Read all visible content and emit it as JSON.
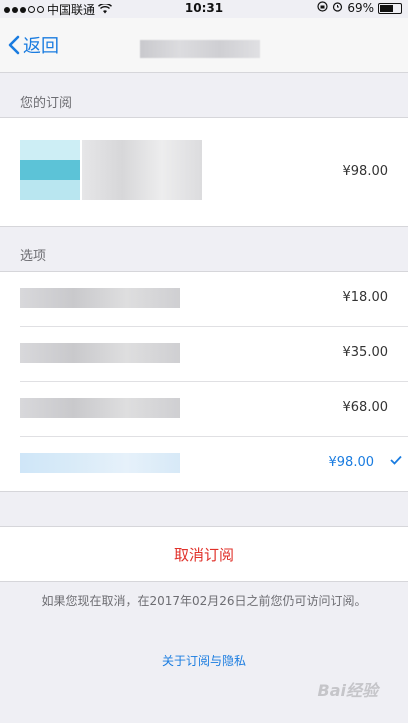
{
  "status_bar": {
    "carrier": "中国联通",
    "time": "10:31",
    "battery": "69%"
  },
  "nav": {
    "back_label": "返回"
  },
  "subscription": {
    "section_title": "您的订阅",
    "price": "¥98.00"
  },
  "options": {
    "section_title": "选项",
    "items": [
      {
        "price": "¥18.00"
      },
      {
        "price": "¥35.00"
      },
      {
        "price": "¥68.00"
      },
      {
        "price": "¥98.00",
        "selected": true
      }
    ]
  },
  "cancel": {
    "label": "取消订阅",
    "note": "如果您现在取消，在2017年02月26日之前您仍可访问订阅。"
  },
  "footer": {
    "link": "关于订阅与隐私",
    "watermark": "Bai经验"
  },
  "colors": {
    "accent": "#1a7ce0",
    "destructive": "#e0312a",
    "background": "#efeff4"
  }
}
